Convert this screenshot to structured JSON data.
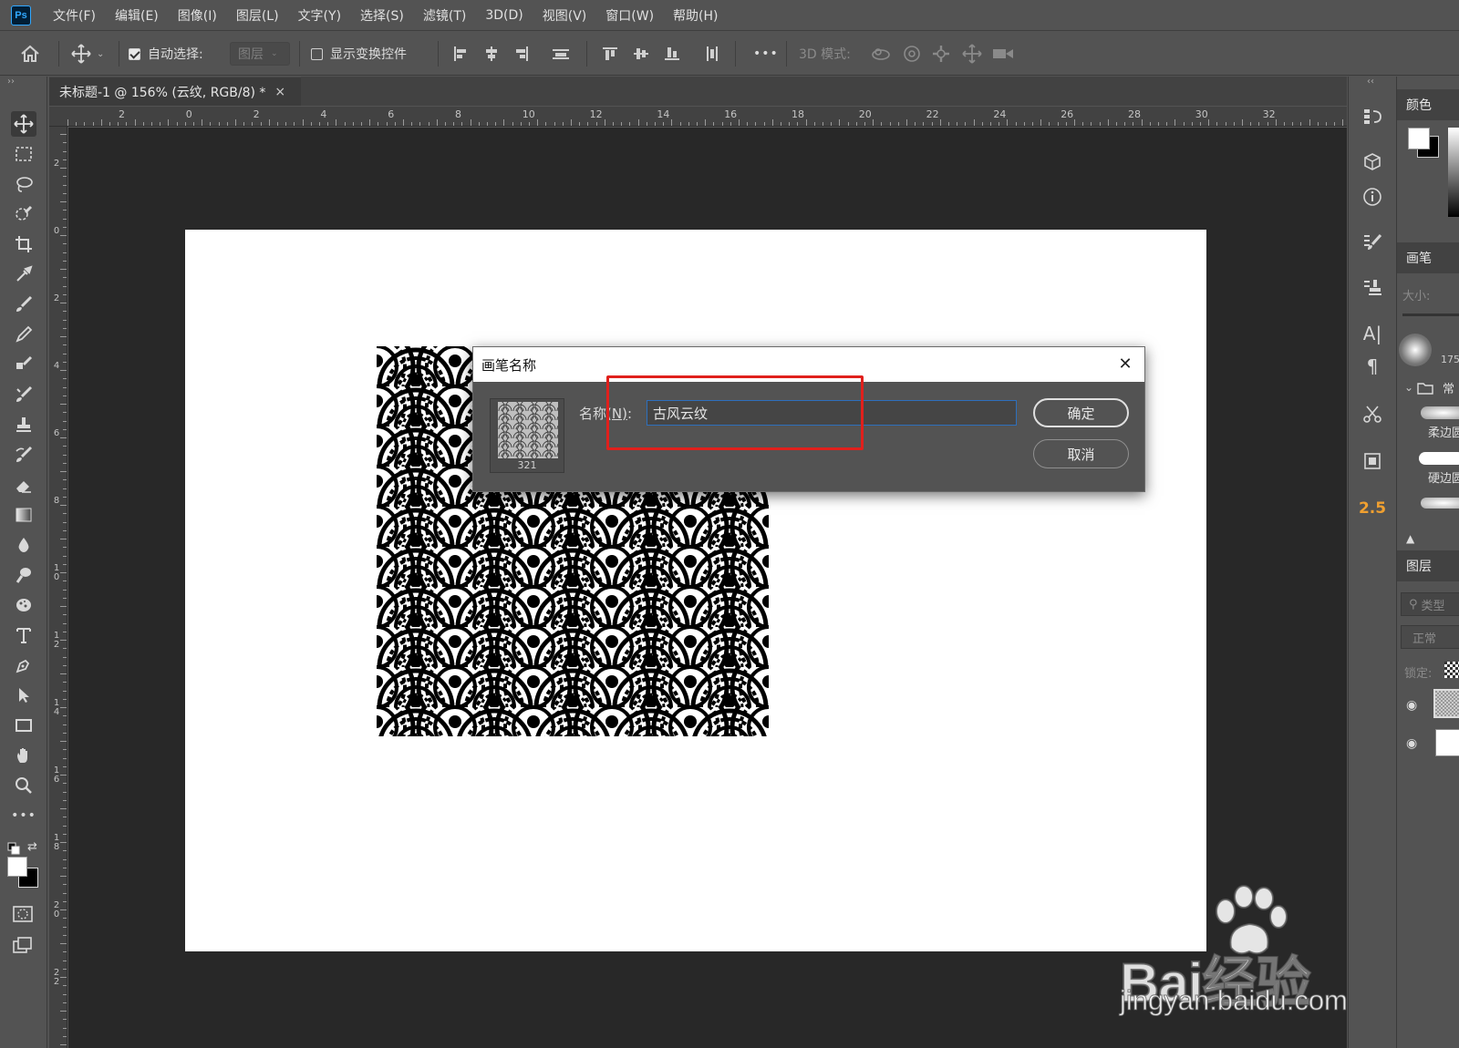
{
  "app": {
    "logo_text": "Ps"
  },
  "menu": [
    "文件(F)",
    "编辑(E)",
    "图像(I)",
    "图层(L)",
    "文字(Y)",
    "选择(S)",
    "滤镜(T)",
    "3D(D)",
    "视图(V)",
    "窗口(W)",
    "帮助(H)"
  ],
  "options": {
    "auto_select_label": "自动选择:",
    "auto_select_checked": true,
    "auto_select_target": "图层",
    "show_transform_label": "显示变换控件",
    "show_transform_checked": false,
    "more": "•••",
    "mode_3d_label": "3D 模式:"
  },
  "document": {
    "tab_title": "未标题-1 @ 156% (云纹, RGB/8) *",
    "close_glyph": "×"
  },
  "ruler_top_labels": [
    "2",
    "0",
    "2",
    "4",
    "6",
    "8",
    "10",
    "12",
    "14",
    "16",
    "18",
    "20",
    "22",
    "24",
    "26",
    "28",
    "30",
    "32"
  ],
  "ruler_left_labels": [
    "2",
    "0",
    "2",
    "4",
    "6",
    "8",
    "10",
    "12",
    "14",
    "16",
    "18",
    "20",
    "22"
  ],
  "toolbar": {
    "more": "•••"
  },
  "right_icons": {
    "adjust_value": "2.5"
  },
  "right_panel": {
    "color_tab": "颜色",
    "brush_tab": "画笔",
    "size_label": "大小:",
    "brush_size_value": "175",
    "group_label": "常",
    "soft_round": "柔边圆",
    "hard_round": "硬边圆",
    "layers_tab": "图层",
    "kind_label": "类型",
    "blend_mode": "正常",
    "lock_label": "锁定:"
  },
  "dialog": {
    "title": "画笔名称",
    "close_glyph": "✕",
    "brush_size": "321",
    "name_label_prefix": "名称",
    "name_label_key": "(N)",
    "name_label_suffix": ":",
    "name_value": "古风云纹",
    "ok_label": "确定",
    "cancel_label": "取消"
  },
  "watermark": {
    "brand": "Bai经验",
    "url": "jingyan.baidu.com"
  },
  "colors": {
    "highlight": "#e0201c",
    "ui_bg": "#535353",
    "canvas_bg": "#282828"
  }
}
